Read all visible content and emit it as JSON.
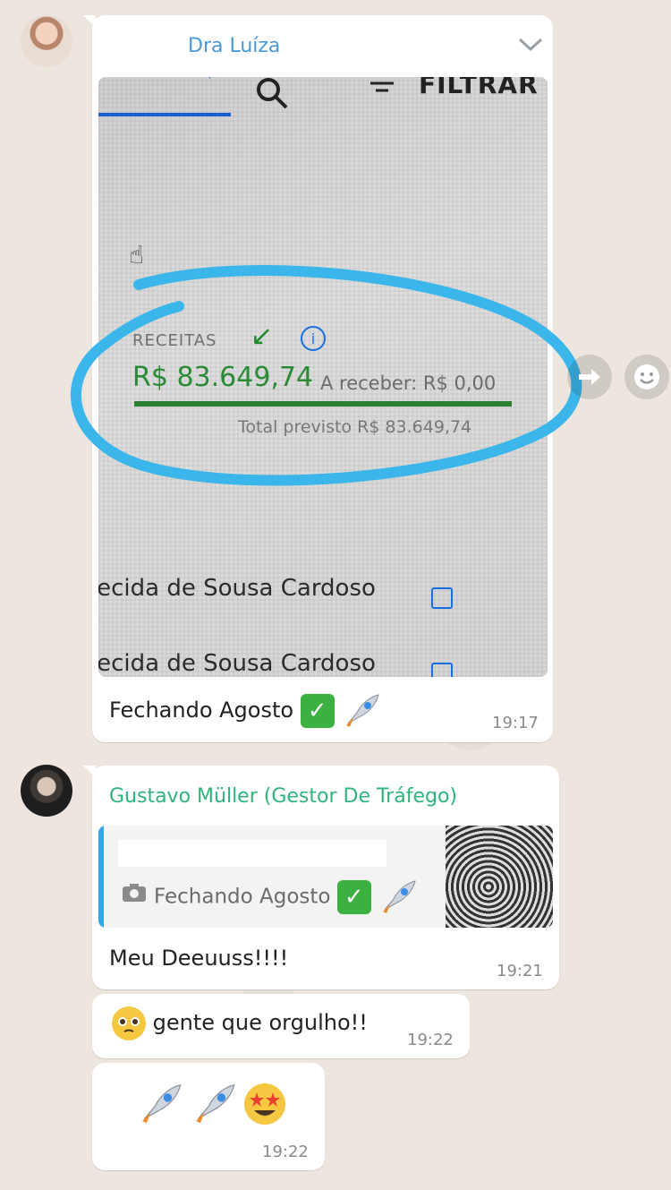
{
  "messages": [
    {
      "sender": "Dra Luíza",
      "caption": "Fechando Agosto",
      "time": "19:17",
      "photo": {
        "filter_label": "FILTRAR",
        "receitas_label": "RECEITAS",
        "amount": "R$ 83.649,74",
        "a_receber": "A receber: R$ 0,00",
        "total_previsto": "Total previsto R$ 83.649,74",
        "name_row_1": "recida de Sousa Cardoso",
        "name_row_2": "recida de Sousa Cardoso"
      }
    },
    {
      "sender": "Gustavo Müller (Gestor De Tráfego)",
      "quote_text": "Fechando Agosto",
      "text": "Meu Deeuuss!!!!",
      "time": "19:21"
    },
    {
      "text": "gente que orgulho!!",
      "time": "19:22"
    },
    {
      "time": "19:22"
    }
  ],
  "colors": {
    "sender_luiza": "#4a9ad8",
    "sender_gustavo": "#2fb47c",
    "highlight_circle": "#3bb6ea"
  },
  "icons": [
    "dropdown-chevron-icon",
    "forward-icon",
    "emoji-react-icon",
    "camera-icon",
    "checkmark-emoji",
    "rocket-emoji",
    "pleading-face-emoji",
    "star-struck-emoji"
  ]
}
